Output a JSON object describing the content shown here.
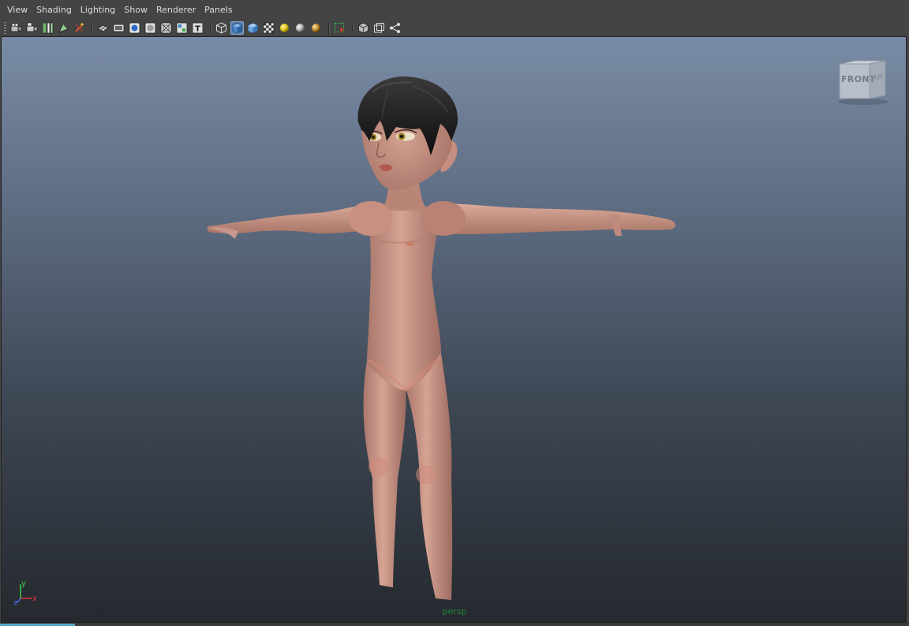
{
  "menu": {
    "items": [
      "View",
      "Shading",
      "Lighting",
      "Show",
      "Renderer",
      "Panels"
    ]
  },
  "toolbar": {
    "groups": [
      [
        "camera-attributes-icon",
        "bookmark-icon",
        "image-plane-icon",
        "2d-pan-zoom-icon",
        "grease-pencil-icon"
      ],
      [
        "grid-icon",
        "film-gate-icon",
        "resolution-gate-icon",
        "gate-mask-icon",
        "field-chart-icon",
        "safe-title-icon"
      ],
      [
        "wireframe-icon",
        "smooth-shade-icon",
        "default-material-icon",
        "textured-icon",
        "use-all-lights-icon",
        "shadows-icon",
        "ambient-occlusion-icon"
      ],
      [
        "isolate-select-icon"
      ],
      [
        "xray-icon",
        "xray-active-components-icon",
        "xray-joints-icon"
      ]
    ],
    "active": [
      "smooth-shade-icon"
    ]
  },
  "viewport": {
    "camera_name": "persp",
    "view_cube": {
      "front": "FRONT",
      "right": "RIGHT"
    },
    "axis": {
      "x": "x",
      "y": "y",
      "z": "z"
    },
    "colors": {
      "background_top": "#7a8ba5",
      "background_bottom": "#25292f",
      "skin": "#c99484",
      "hair": "#151515",
      "camera_label": "#1d8a3b"
    }
  }
}
